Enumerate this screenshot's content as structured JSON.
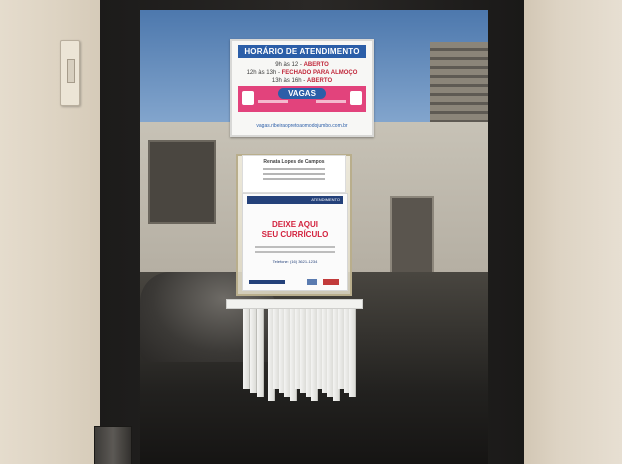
{
  "notice": {
    "title": "HORÁRIO DE ATENDIMENTO",
    "line1_time": "9h às 12 - ",
    "line1_status": "ABERTO",
    "line2_time": "12h às 13h - ",
    "line2_status": "FECHADO PARA ALMOÇO",
    "line3_time": "13h às 16h - ",
    "line3_status": "ABERTO",
    "vagas": "VAGAS",
    "footer": "vagas.ribeiraopretoaomodojumbo.com.br"
  },
  "cv_card": {
    "name": "Renata Lopes de Campos"
  },
  "cv_flyer": {
    "header": "ATENDIMENTO",
    "title_line1": "DEIXE AQUI",
    "title_line2": "SEU CURRÍCULO",
    "phone": "Telefone: (16) 3621-1234"
  },
  "colors": {
    "notice_blue": "#2b5ea8",
    "notice_pink": "#e2437c",
    "flyer_red": "#d3233f",
    "door_frame": "#1f1e1c"
  },
  "tear_tabs_count": 19
}
